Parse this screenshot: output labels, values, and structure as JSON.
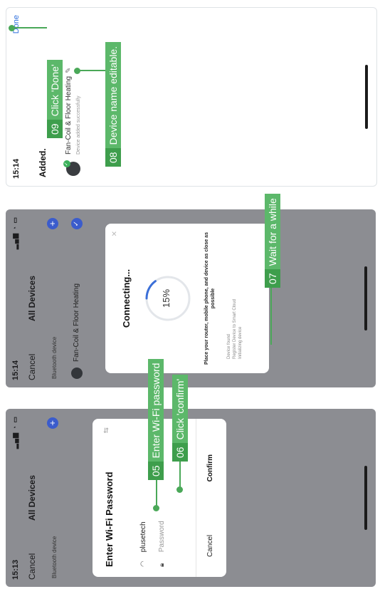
{
  "screen1": {
    "time": "15:13",
    "nav_cancel": "Cancel",
    "nav_title": "All Devices",
    "section_label": "Bluetooth device",
    "dialog": {
      "title": "Enter Wi-Fi Password",
      "ssid": "plusetech",
      "password_placeholder": "Password",
      "cancel_label": "Cancel",
      "confirm_label": "Confirm"
    }
  },
  "screen2": {
    "time": "15:14",
    "nav_cancel": "Cancel",
    "nav_title": "All Devices",
    "section_label": "Bluetooth device",
    "device_name": "Fan-Coil & Floor Heating",
    "connecting": {
      "title": "Connecting...",
      "progress_label": "15%",
      "progress": 0.15,
      "hint": "Place your router, mobile phone, and device as close as possible",
      "step1": "Device found",
      "step2": "Register Device to Smart Cloud",
      "step3": "Initializing device"
    }
  },
  "screen3": {
    "time": "15:14",
    "done_label": "Done",
    "header": "Added.",
    "device_name": "Fan-Coil & Floor Heating",
    "device_status": "Device added successfully"
  },
  "annotations": {
    "a05": {
      "num": "05",
      "text": "Enter Wi-Fi password"
    },
    "a06": {
      "num": "06",
      "text": "Click 'confirm'"
    },
    "a07": {
      "num": "07",
      "text": "Wait for a while"
    },
    "a08": {
      "num": "08",
      "text": "Device name editable."
    },
    "a09": {
      "num": "09",
      "text": "Click 'Done'"
    }
  },
  "colors": {
    "annotation_green": "#5cb86a",
    "accent_blue": "#3b5ccc"
  }
}
